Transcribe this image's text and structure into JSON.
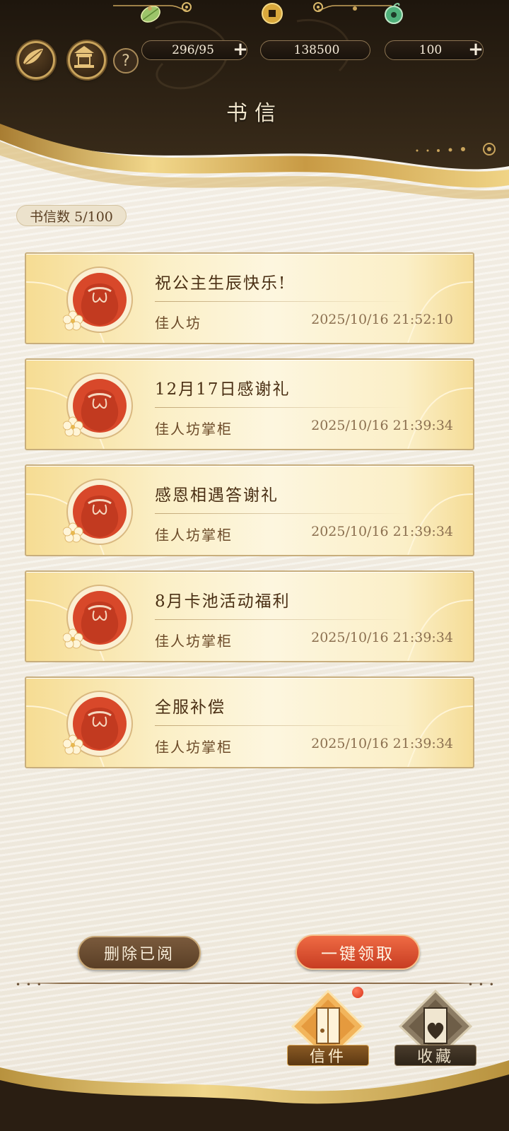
{
  "header": {
    "title": "书信",
    "resources": [
      {
        "icon": "leaf-ticket-icon",
        "value": "296/95"
      },
      {
        "icon": "copper-coin-icon",
        "value": "138500"
      },
      {
        "icon": "jade-icon",
        "value": "100"
      }
    ],
    "help_label": "?"
  },
  "mail_count_label": "书信数 5/100",
  "mails": [
    {
      "title": "祝公主生辰快乐!",
      "sender": "佳人坊",
      "time": "2025/10/16 21:52:10"
    },
    {
      "title": "12月17日感谢礼",
      "sender": "佳人坊掌柜",
      "time": "2025/10/16 21:39:34"
    },
    {
      "title": "感恩相遇答谢礼",
      "sender": "佳人坊掌柜",
      "time": "2025/10/16 21:39:34"
    },
    {
      "title": "8月卡池活动福利",
      "sender": "佳人坊掌柜",
      "time": "2025/10/16 21:39:34"
    },
    {
      "title": "全服补偿",
      "sender": "佳人坊掌柜",
      "time": "2025/10/16 21:39:34"
    }
  ],
  "actions": {
    "delete_read": "删除已阅",
    "claim_all": "一键领取"
  },
  "tabs": {
    "mail": "信件",
    "favorites": "收藏"
  },
  "colors": {
    "header_dark": "#2a1e12",
    "gold_accent": "#c9a45c",
    "card_gold": "#f6dc93",
    "claim_red": "#d8482a",
    "delete_brown": "#6a4c30"
  }
}
